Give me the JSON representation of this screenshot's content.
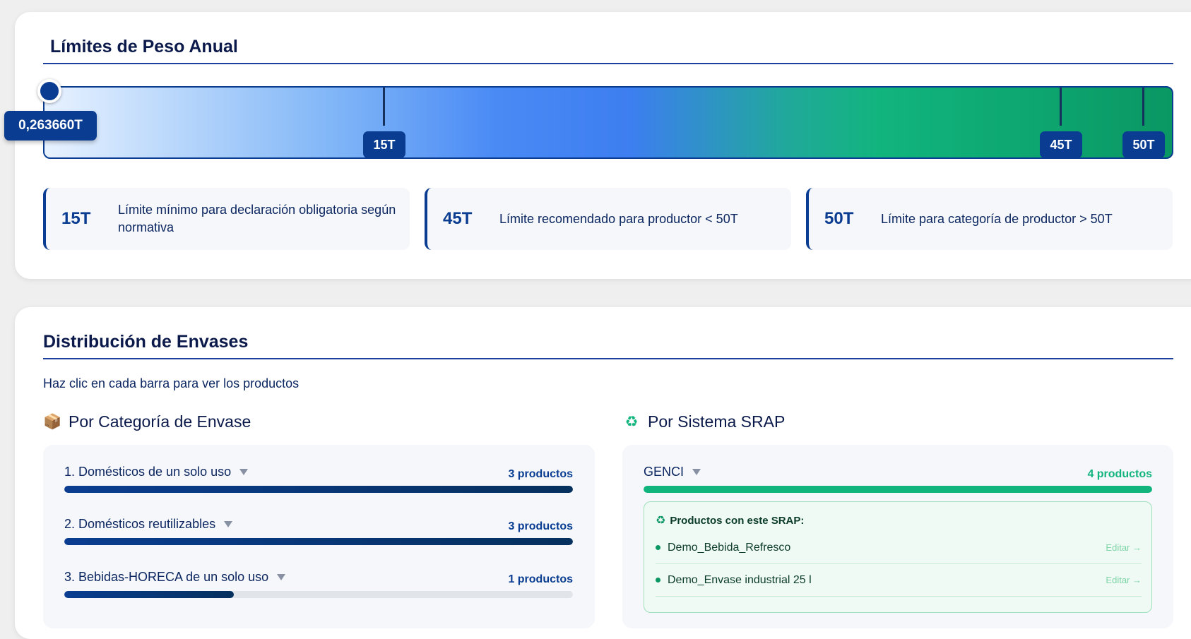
{
  "limits": {
    "title": "Límites de Peso Anual",
    "current_value": "0,263660T",
    "current_fraction": 0.0053,
    "ticks": [
      {
        "label": "15T",
        "value": 15
      },
      {
        "label": "45T",
        "value": 45
      },
      {
        "label": "50T",
        "value": 50
      }
    ],
    "cards": [
      {
        "value": "15T",
        "description": "Límite mínimo para declaración obligatoria según normativa"
      },
      {
        "value": "45T",
        "description": "Límite recomendado para productor < 50T"
      },
      {
        "value": "50T",
        "description": "Límite para categoría de productor > 50T"
      }
    ]
  },
  "distribution": {
    "title": "Distribución de Envases",
    "hint": "Haz clic en cada barra para ver los productos",
    "by_category": {
      "icon": "package-icon",
      "title": "Por Categoría de Envase",
      "rows": [
        {
          "label": "1. Domésticos de un solo uso",
          "count": "3 productos",
          "fraction": 1.0
        },
        {
          "label": "2. Domésticos reutilizables",
          "count": "3 productos",
          "fraction": 1.0
        },
        {
          "label": "3. Bebidas-HORECA de un solo uso",
          "count": "1 productos",
          "fraction": 0.333
        }
      ]
    },
    "by_srap": {
      "icon": "recycle-icon",
      "title": "Por Sistema SRAP",
      "rows": [
        {
          "label": "GENCI",
          "count": "4 productos",
          "fraction": 1.0
        }
      ],
      "expanded": {
        "heading": "Productos con este SRAP:",
        "items": [
          {
            "name": "Demo_Bebida_Refresco",
            "action": "Editar →"
          },
          {
            "name": "Demo_Envase industrial 25 l",
            "action": "Editar →"
          }
        ]
      }
    }
  },
  "colors": {
    "primary": "#0a3d91",
    "success": "#12b47e"
  }
}
